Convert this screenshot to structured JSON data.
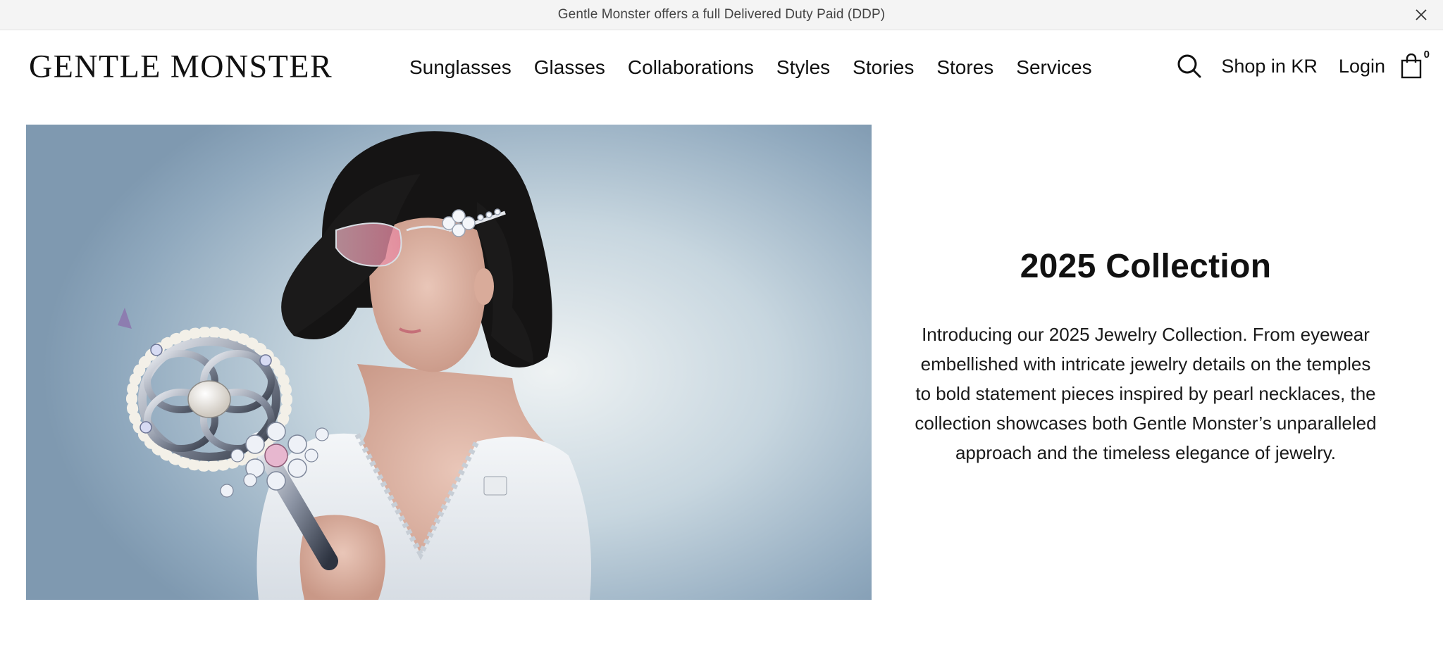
{
  "announcement": {
    "text": "Gentle Monster offers a full Delivered Duty Paid (DDP)",
    "close_icon": "close-icon"
  },
  "header": {
    "logo": "GENTLE MONSTER",
    "nav": [
      {
        "label": "Sunglasses"
      },
      {
        "label": "Glasses"
      },
      {
        "label": "Collaborations"
      },
      {
        "label": "Styles"
      },
      {
        "label": "Stories"
      },
      {
        "label": "Stores"
      },
      {
        "label": "Services"
      }
    ],
    "search_icon": "search-icon",
    "shop_region": "Shop in KR",
    "login": "Login",
    "cart_icon": "shopping-bag-icon",
    "cart_count": "0"
  },
  "hero": {
    "title": "2025 Collection",
    "description": "Introducing our 2025 Jewelry Collection. From eyewear embellished with intricate jewelry details on the temples to bold statement pieces inspired by pearl necklaces, the collection showcases both Gentle Monster’s unparalleled approach and the timeless elegance of jewelry."
  },
  "colors": {
    "announcement_bg": "#f4f4f4",
    "text": "#111111",
    "hero_bg": "#a9bfcf"
  }
}
